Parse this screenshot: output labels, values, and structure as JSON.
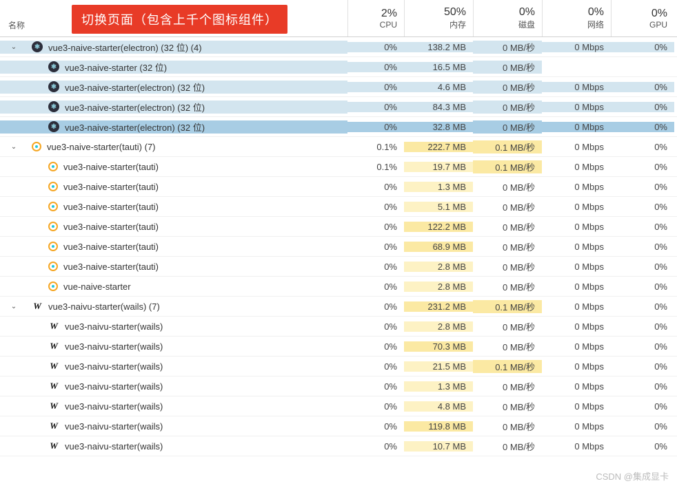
{
  "header": {
    "name_label": "名称",
    "banner": "切换页面（包含上千个图标组件）",
    "cols": {
      "cpu": {
        "pct": "2%",
        "label": "CPU"
      },
      "mem": {
        "pct": "50%",
        "label": "内存"
      },
      "disk": {
        "pct": "0%",
        "label": "磁盘"
      },
      "net": {
        "pct": "0%",
        "label": "网络"
      },
      "gpu": {
        "pct": "0%",
        "label": "GPU"
      }
    }
  },
  "groups": [
    {
      "name": "vue3-naive-starter(electron) (32 位) (4)",
      "icon": "electron",
      "style": "blue",
      "cpu": "0%",
      "mem": "138.2 MB",
      "disk": "0 MB/秒",
      "net": "0 Mbps",
      "gpu": "0%",
      "children": [
        {
          "name": "vue3-naive-starter (32 位)",
          "icon": "electron",
          "cpu": "0%",
          "mem": "16.5 MB",
          "disk": "0 MB/秒",
          "net": "",
          "gpu": ""
        },
        {
          "name": "vue3-naive-starter(electron) (32 位)",
          "icon": "electron",
          "cpu": "0%",
          "mem": "4.6 MB",
          "disk": "0 MB/秒",
          "net": "0 Mbps",
          "gpu": "0%"
        },
        {
          "name": "vue3-naive-starter(electron) (32 位)",
          "icon": "electron",
          "cpu": "0%",
          "mem": "84.3 MB",
          "disk": "0 MB/秒",
          "net": "0 Mbps",
          "gpu": "0%"
        },
        {
          "name": "vue3-naive-starter(electron) (32 位)",
          "icon": "electron",
          "sel": true,
          "cpu": "0%",
          "mem": "32.8 MB",
          "disk": "0 MB/秒",
          "net": "0 Mbps",
          "gpu": "0%"
        }
      ]
    },
    {
      "name": "vue3-naive-starter(tauti) (7)",
      "icon": "tauti",
      "cpu": "0.1%",
      "mem": "222.7 MB",
      "disk": "0.1 MB/秒",
      "net": "0 Mbps",
      "gpu": "0%",
      "mem_hl": 2,
      "disk_hl": 2,
      "children": [
        {
          "name": "vue3-naive-starter(tauti)",
          "icon": "tauti",
          "cpu": "0.1%",
          "mem": "19.7 MB",
          "disk": "0.1 MB/秒",
          "net": "0 Mbps",
          "gpu": "0%",
          "mem_hl": 1,
          "disk_hl": 2
        },
        {
          "name": "vue3-naive-starter(tauti)",
          "icon": "tauti",
          "cpu": "0%",
          "mem": "1.3 MB",
          "disk": "0 MB/秒",
          "net": "0 Mbps",
          "gpu": "0%",
          "mem_hl": 1
        },
        {
          "name": "vue3-naive-starter(tauti)",
          "icon": "tauti",
          "cpu": "0%",
          "mem": "5.1 MB",
          "disk": "0 MB/秒",
          "net": "0 Mbps",
          "gpu": "0%",
          "mem_hl": 1
        },
        {
          "name": "vue3-naive-starter(tauti)",
          "icon": "tauti",
          "cpu": "0%",
          "mem": "122.2 MB",
          "disk": "0 MB/秒",
          "net": "0 Mbps",
          "gpu": "0%",
          "mem_hl": 2
        },
        {
          "name": "vue3-naive-starter(tauti)",
          "icon": "tauti",
          "cpu": "0%",
          "mem": "68.9 MB",
          "disk": "0 MB/秒",
          "net": "0 Mbps",
          "gpu": "0%",
          "mem_hl": 2
        },
        {
          "name": "vue3-naive-starter(tauti)",
          "icon": "tauti",
          "cpu": "0%",
          "mem": "2.8 MB",
          "disk": "0 MB/秒",
          "net": "0 Mbps",
          "gpu": "0%",
          "mem_hl": 1
        },
        {
          "name": "vue-naive-starter",
          "icon": "tauti",
          "cpu": "0%",
          "mem": "2.8 MB",
          "disk": "0 MB/秒",
          "net": "0 Mbps",
          "gpu": "0%",
          "mem_hl": 1
        }
      ]
    },
    {
      "name": "vue3-naivu-starter(wails) (7)",
      "icon": "wails",
      "cpu": "0%",
      "mem": "231.2 MB",
      "disk": "0.1 MB/秒",
      "net": "0 Mbps",
      "gpu": "0%",
      "mem_hl": 2,
      "disk_hl": 2,
      "children": [
        {
          "name": "vue3-naivu-starter(wails)",
          "icon": "wails",
          "cpu": "0%",
          "mem": "2.8 MB",
          "disk": "0 MB/秒",
          "net": "0 Mbps",
          "gpu": "0%",
          "mem_hl": 1
        },
        {
          "name": "vue3-naivu-starter(wails)",
          "icon": "wails",
          "cpu": "0%",
          "mem": "70.3 MB",
          "disk": "0 MB/秒",
          "net": "0 Mbps",
          "gpu": "0%",
          "mem_hl": 2
        },
        {
          "name": "vue3-naivu-starter(wails)",
          "icon": "wails",
          "cpu": "0%",
          "mem": "21.5 MB",
          "disk": "0.1 MB/秒",
          "net": "0 Mbps",
          "gpu": "0%",
          "mem_hl": 1,
          "disk_hl": 2
        },
        {
          "name": "vue3-naivu-starter(wails)",
          "icon": "wails",
          "cpu": "0%",
          "mem": "1.3 MB",
          "disk": "0 MB/秒",
          "net": "0 Mbps",
          "gpu": "0%",
          "mem_hl": 1
        },
        {
          "name": "vue3-naivu-starter(wails)",
          "icon": "wails",
          "cpu": "0%",
          "mem": "4.8 MB",
          "disk": "0 MB/秒",
          "net": "0 Mbps",
          "gpu": "0%",
          "mem_hl": 1
        },
        {
          "name": "vue3-naivu-starter(wails)",
          "icon": "wails",
          "cpu": "0%",
          "mem": "119.8 MB",
          "disk": "0 MB/秒",
          "net": "0 Mbps",
          "gpu": "0%",
          "mem_hl": 2
        },
        {
          "name": "vue3-naivu-starter(wails)",
          "icon": "wails",
          "cpu": "0%",
          "mem": "10.7 MB",
          "disk": "0 MB/秒",
          "net": "0 Mbps",
          "gpu": "0%",
          "mem_hl": 1
        }
      ]
    }
  ],
  "watermark": "CSDN @集成显卡"
}
